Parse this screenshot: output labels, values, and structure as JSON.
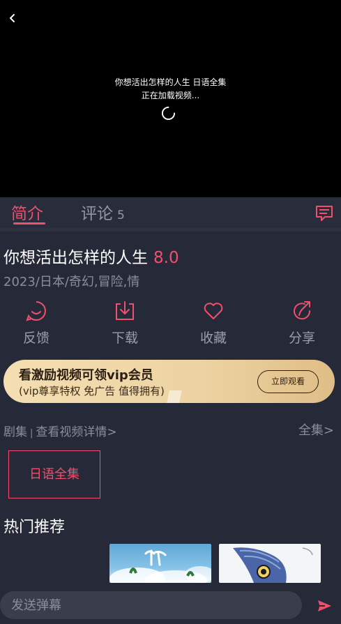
{
  "player": {
    "video_title": "你想活出怎样的人生 日语全集",
    "loading_status": "正在加载视频..."
  },
  "tabs": {
    "intro_label": "简介",
    "comments_label": "评论",
    "comments_count": "5"
  },
  "details": {
    "title": "你想活出怎样的人生",
    "score": "8.0",
    "meta": "2023/日本/奇幻,冒险,情"
  },
  "actions": [
    {
      "label": "反馈",
      "icon": "feedback-smile-icon"
    },
    {
      "label": "下载",
      "icon": "download-icon"
    },
    {
      "label": "收藏",
      "icon": "heart-icon"
    },
    {
      "label": "分享",
      "icon": "share-icon"
    }
  ],
  "banner": {
    "title": "看激励视频可领vip会员",
    "subtitle": "(vip尊享特权 免广告 值得拥有)",
    "button_label": "立即观看"
  },
  "episodes": {
    "label": "剧集",
    "separator": "|",
    "details_link": "查看视频详情>",
    "all_link": "全集>",
    "items": [
      "日语全集"
    ]
  },
  "recommendations": {
    "title": "热门推荐"
  },
  "danmaku": {
    "placeholder": "发送弹幕"
  },
  "colors": {
    "accent": "#f0506e",
    "background": "#262a38",
    "player_background": "#000000",
    "muted_text": "#8a8e9c",
    "banner_gold": "#f0d7a6"
  }
}
